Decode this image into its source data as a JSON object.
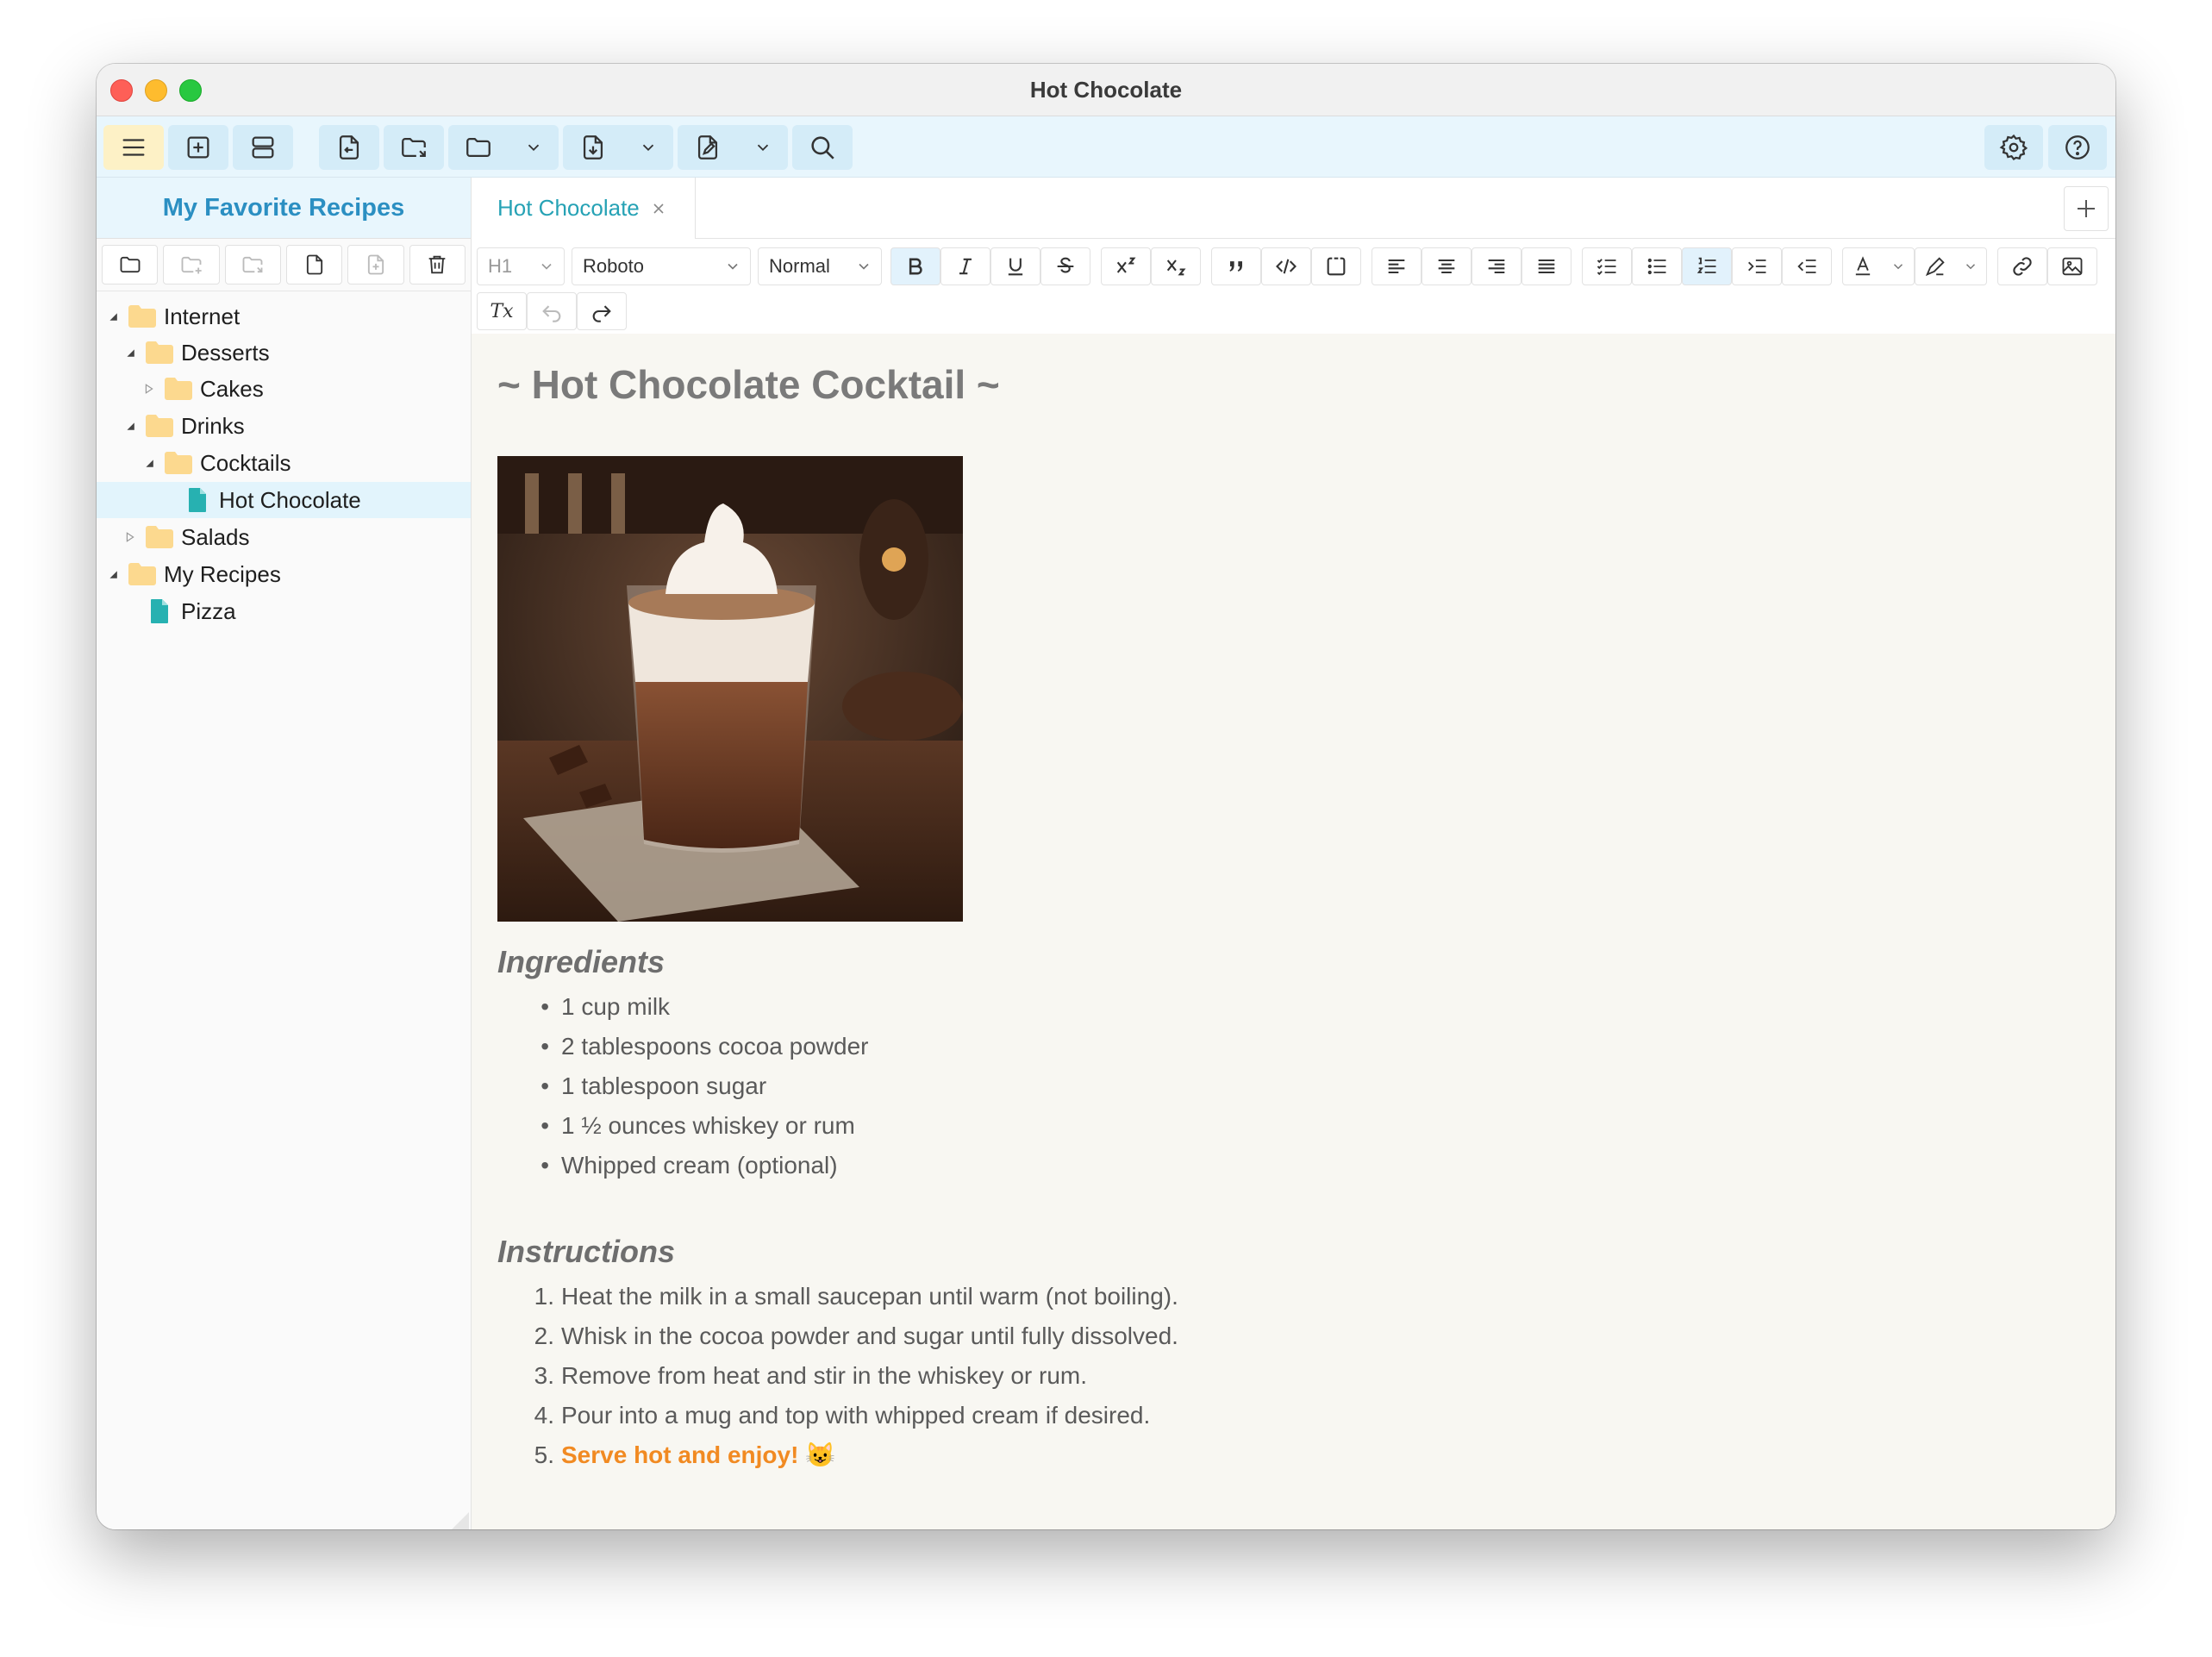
{
  "window": {
    "title": "Hot Chocolate"
  },
  "sidebar": {
    "header": "My Favorite Recipes",
    "tree": [
      {
        "label": "Internet",
        "type": "folder",
        "state": "expanded",
        "level": 0
      },
      {
        "label": "Desserts",
        "type": "folder",
        "state": "expanded",
        "level": 1
      },
      {
        "label": "Cakes",
        "type": "folder",
        "state": "collapsed",
        "level": 2
      },
      {
        "label": "Drinks",
        "type": "folder",
        "state": "expanded",
        "level": 1
      },
      {
        "label": "Cocktails",
        "type": "folder",
        "state": "expanded",
        "level": 2
      },
      {
        "label": "Hot Chocolate",
        "type": "file",
        "state": "selected",
        "level": 3
      },
      {
        "label": "Salads",
        "type": "folder",
        "state": "collapsed",
        "level": 1
      },
      {
        "label": "My Recipes",
        "type": "folder",
        "state": "expanded",
        "level": 0
      },
      {
        "label": "Pizza",
        "type": "file",
        "state": "none",
        "level": 1
      }
    ]
  },
  "tabs": [
    {
      "label": "Hot Chocolate",
      "active": true
    }
  ],
  "format_toolbar": {
    "heading": "H1",
    "font": "Roboto",
    "size": "Normal",
    "clear_format_label": "Tx"
  },
  "document": {
    "title": "~ Hot Chocolate Cocktail ~",
    "image": "hot chocolate cocktail photo",
    "ingredients_heading": "Ingredients",
    "ingredients": [
      "1 cup milk",
      "2 tablespoons cocoa powder",
      "1 tablespoon sugar",
      "1 ½ ounces whiskey or rum",
      "Whipped cream (optional)"
    ],
    "instructions_heading": "Instructions",
    "instructions": [
      "Heat the milk in a small saucepan until warm (not boiling).",
      "Whisk in the cocoa powder and sugar until fully dissolved.",
      "Remove from heat and stir in the whiskey or rum.",
      "Pour into a mug and top with whipped cream if desired."
    ],
    "final_step": "Serve hot and enjoy!",
    "final_emoji": "😺"
  },
  "colors": {
    "accent": "#2b8fc2",
    "tab_text": "#26a2b5",
    "highlight": "#f18a22",
    "file_icon": "#27b1b1",
    "folder_icon": "#fcd98f"
  }
}
